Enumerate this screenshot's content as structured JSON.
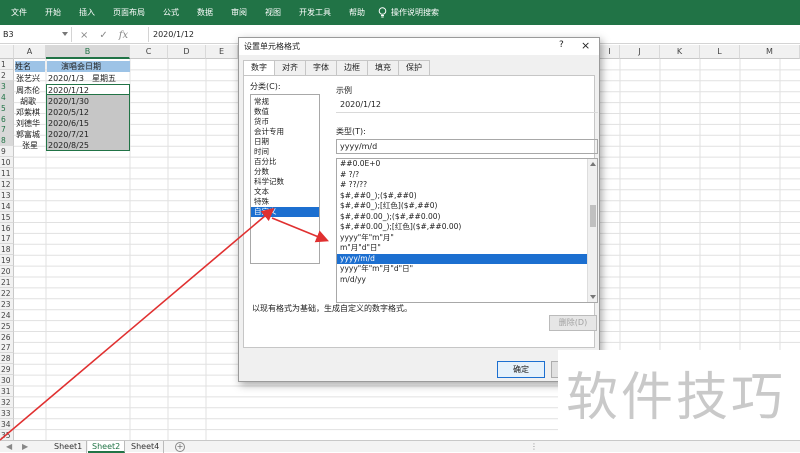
{
  "ribbon": {
    "tabs": [
      "文件",
      "开始",
      "插入",
      "页面布局",
      "公式",
      "数据",
      "审阅",
      "视图",
      "开发工具",
      "帮助"
    ],
    "tell_me": "操作说明搜索"
  },
  "formula_bar": {
    "name_box": "B3",
    "cancel_icon": "×",
    "enter_icon": "✓",
    "fx_label": "fx",
    "value": "2020/1/12"
  },
  "grid": {
    "columns": [
      "A",
      "B",
      "C",
      "D",
      "E",
      "F",
      "G",
      "H",
      "I",
      "J",
      "K",
      "L",
      "M"
    ],
    "rows": [
      "1",
      "2",
      "3",
      "4",
      "5",
      "6",
      "7",
      "8",
      "9",
      "10",
      "11",
      "12",
      "13",
      "14",
      "15",
      "16",
      "17",
      "18",
      "19",
      "20",
      "21",
      "22",
      "23",
      "24",
      "25",
      "26",
      "27",
      "28",
      "29",
      "30",
      "31",
      "32",
      "33",
      "34",
      "35"
    ],
    "header_row": {
      "a": "姓名",
      "b": "演唱会日期"
    },
    "data": [
      {
        "a": "张艺兴",
        "b": "2020/1/3",
        "c": "星期五"
      },
      {
        "a": "周杰伦",
        "b": "2020/1/12"
      },
      {
        "a": "胡歌",
        "b": "2020/1/30"
      },
      {
        "a": "邓紫棋",
        "b": "2020/5/12"
      },
      {
        "a": "刘德华",
        "b": "2020/6/15"
      },
      {
        "a": "郭富城",
        "b": "2020/7/21"
      },
      {
        "a": "张星",
        "b": "2020/8/25"
      }
    ]
  },
  "sheets": {
    "tabs": [
      "Sheet1",
      "Sheet2",
      "Sheet4"
    ],
    "active": "Sheet2"
  },
  "dialog": {
    "title": "设置单元格格式",
    "help": "?",
    "close": "×",
    "tabs": [
      "数字",
      "对齐",
      "字体",
      "边框",
      "填充",
      "保护"
    ],
    "category_label": "分类(C):",
    "categories": [
      "常规",
      "数值",
      "货币",
      "会计专用",
      "日期",
      "时间",
      "百分比",
      "分数",
      "科学记数",
      "文本",
      "特殊",
      "自定义"
    ],
    "selected_category": "自定义",
    "sample_label": "示例",
    "sample_value": "2020/1/12",
    "type_label": "类型(T):",
    "type_value": "yyyy/m/d",
    "type_list": [
      "##0.0E+0",
      "# ?/?",
      "# ??/??",
      "$#,##0_);($#,##0)",
      "$#,##0_);[红色]($#,##0)",
      "$#,##0.00_);($#,##0.00)",
      "$#,##0.00_);[红色]($#,##0.00)",
      "yyyy\"年\"m\"月\"",
      "m\"月\"d\"日\"",
      "yyyy/m/d",
      "yyyy\"年\"m\"月\"d\"日\"",
      "m/d/yy"
    ],
    "selected_type": "yyyy/m/d",
    "delete_button": "删除(D)",
    "description": "以现有格式为基础，生成自定义的数字格式。",
    "ok_button": "确定"
  },
  "watermark": "软件技巧",
  "colors": {
    "excel_green": "#217346",
    "selection_blue": "#1c6fd0",
    "arrow_red": "#e03030"
  }
}
